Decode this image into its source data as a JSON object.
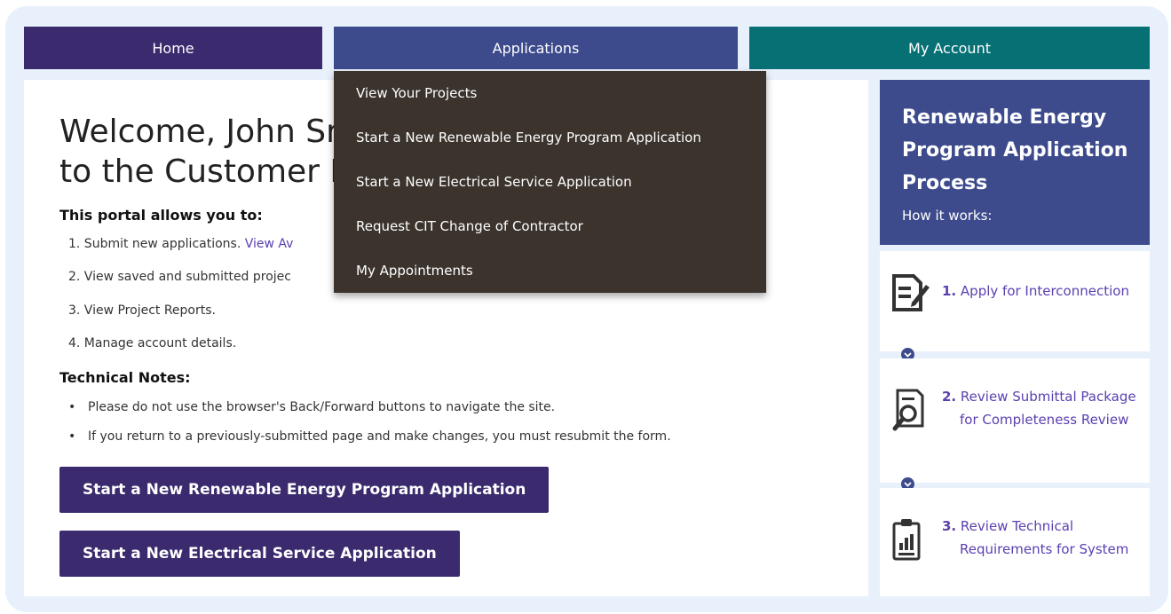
{
  "nav": {
    "home": "Home",
    "applications": "Applications",
    "my_account": "My Account"
  },
  "dropdown": {
    "items": [
      "View Your Projects",
      "Start a New Renewable Energy Program Application",
      "Start a New Electrical Service Application",
      "Request CIT Change of Contractor",
      "My Appointments"
    ]
  },
  "main": {
    "welcome_line1": "Welcome, John Sr",
    "welcome_line2": "to the Customer I",
    "portal_heading": "This portal allows you to:",
    "portal_items": [
      {
        "text": "1. Submit new applications. ",
        "link": "View Av"
      },
      {
        "text": "2. View saved and submitted projec"
      },
      {
        "text": "3. View Project Reports."
      },
      {
        "text": "4. Manage account details."
      }
    ],
    "tech_heading": "Technical Notes:",
    "tech_notes": [
      "Please do not use the browser's Back/Forward buttons to navigate the site.",
      "If you return to a previously-submitted page and make changes, you must resubmit the form."
    ],
    "btn_renewable": "Start a New Renewable Energy Program Application",
    "btn_electrical": "Start a New Electrical Service Application"
  },
  "side": {
    "title": "Renewable Energy Program Application Process",
    "subtitle": "How it works:",
    "steps": [
      {
        "num": "1.",
        "label": "Apply for Interconnection",
        "icon": "edit-form-icon"
      },
      {
        "num": "2.",
        "label": "Review Submittal Package for Completeness Review",
        "icon": "document-search-icon"
      },
      {
        "num": "3.",
        "label": "Review Technical Requirements for System",
        "icon": "clipboard-chart-icon"
      }
    ]
  },
  "colors": {
    "nav_home": "#3b2a6e",
    "nav_apps": "#3d4b8d",
    "nav_account": "#077075",
    "dropdown_bg": "#3b332c",
    "link": "#5b3fb0"
  }
}
